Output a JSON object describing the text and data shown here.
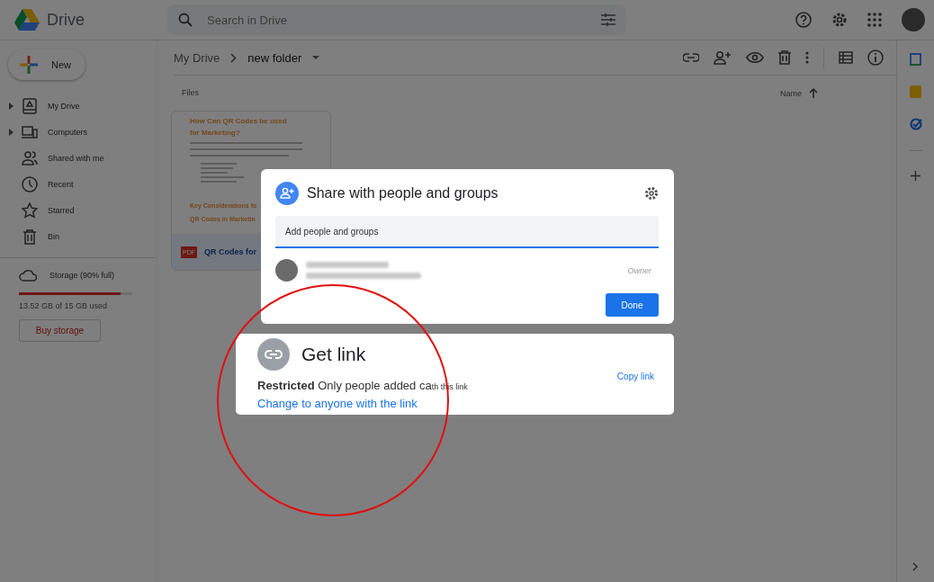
{
  "app": {
    "name": "Drive"
  },
  "search": {
    "placeholder": "Search in Drive"
  },
  "new_button": {
    "label": "New"
  },
  "sidebar": {
    "items": [
      {
        "label": "My Drive",
        "kind": "drive",
        "expandable": true
      },
      {
        "label": "Computers",
        "kind": "computers",
        "expandable": true
      },
      {
        "label": "Shared with me",
        "kind": "shared",
        "expandable": false
      },
      {
        "label": "Recent",
        "kind": "recent",
        "expandable": false
      },
      {
        "label": "Starred",
        "kind": "starred",
        "expandable": false
      },
      {
        "label": "Bin",
        "kind": "bin",
        "expandable": false
      }
    ]
  },
  "storage": {
    "label": "Storage (90% full)",
    "level": 0.9,
    "used": "13.52 GB of 15 GB used",
    "button": "Buy storage"
  },
  "breadcrumb": [
    {
      "label": "My Drive"
    },
    {
      "label": "new folder"
    }
  ],
  "files_heading": "Files",
  "sort": {
    "label": "Name"
  },
  "file": {
    "heading_1": "How Can QR Codes be used for Marketing?",
    "heading_2": "Key Considerations fo",
    "heading_3": "QR Codes in Marketin",
    "badge": "PDF",
    "name": "QR Codes for"
  },
  "share_dialog": {
    "title": "Share with people and groups",
    "placeholder": "Add people and groups",
    "role": "Owner",
    "done": "Done"
  },
  "get_link": {
    "title": "Get link",
    "description": "**Restricted** Only people added ca",
    "description_tail": "th this link",
    "change_link": "Change to anyone with the link",
    "copy_link": "Copy link"
  }
}
